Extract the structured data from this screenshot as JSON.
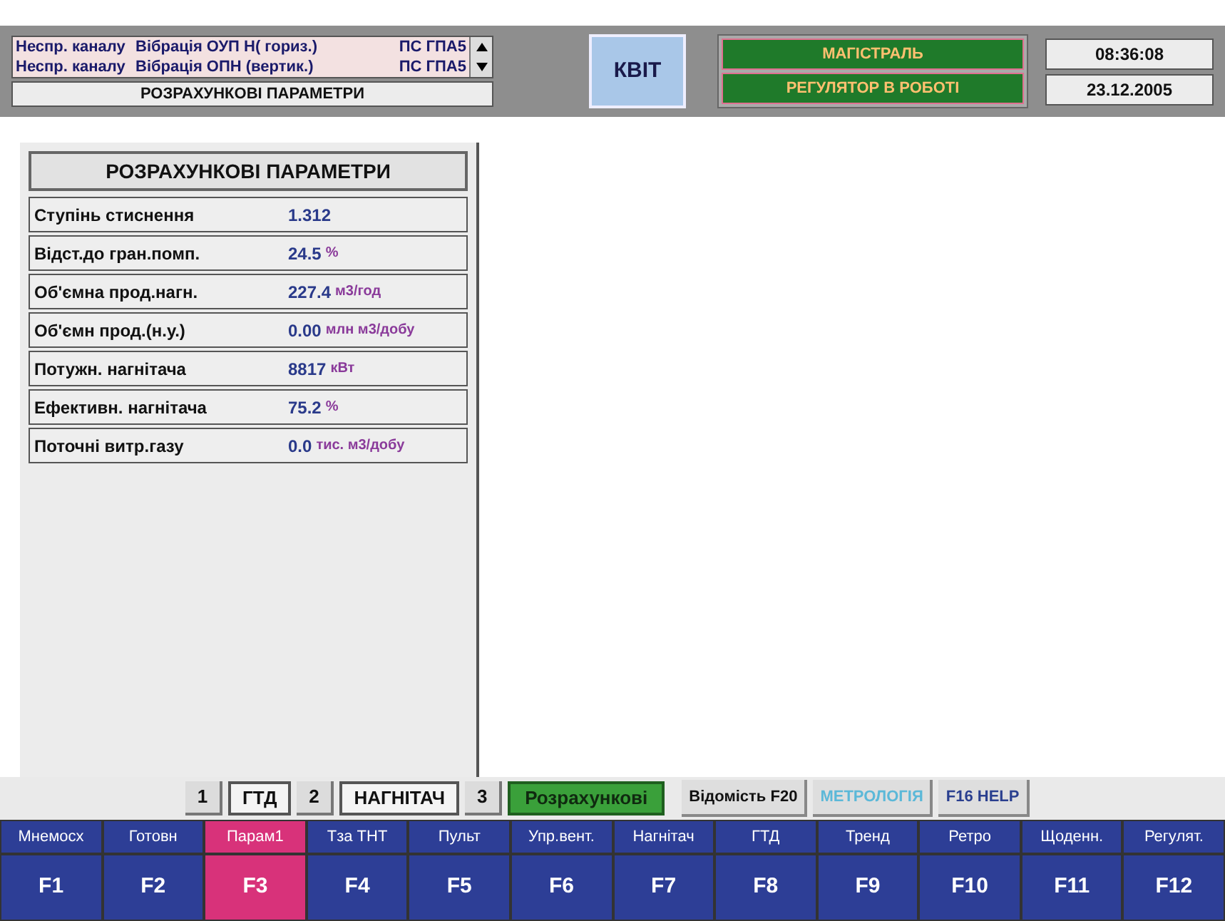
{
  "alarms": [
    {
      "source": "Неспр. каналу",
      "message": "Вібрація ОУП Н( гориз.)",
      "unit": "ПС ГПА5"
    },
    {
      "source": "Неспр. каналу",
      "message": "Вібрація ОПН (вертик.)",
      "unit": "ПС ГПА5"
    }
  ],
  "screen_title": "РОЗРАХУНКОВІ ПАРАМЕТРИ",
  "ack_button": "КВІТ",
  "status": [
    "МАГІСТРАЛЬ",
    "РЕГУЛЯТОР В РОБОТІ"
  ],
  "time": "08:36:08",
  "date": "23.12.2005",
  "panel": {
    "title": "РОЗРАХУНКОВІ ПАРАМЕТРИ",
    "rows": [
      {
        "label": "Ступінь стиснення",
        "value": "1.312",
        "unit": ""
      },
      {
        "label": "Відст.до гран.помп.",
        "value": "24.5",
        "unit": "%"
      },
      {
        "label": "Об'ємна прод.нагн.",
        "value": "227.4",
        "unit": "м3/год"
      },
      {
        "label": "Об'ємн прод.(н.у.)",
        "value": "0.00",
        "unit": "млн м3/добу"
      },
      {
        "label": "Потужн. нагнітача",
        "value": "8817",
        "unit": "кВт"
      },
      {
        "label": "Ефективн. нагнітача",
        "value": "75.2",
        "unit": "%"
      },
      {
        "label": "Поточні витр.газу",
        "value": "0.0",
        "unit": "тис. м3/добу"
      }
    ]
  },
  "tabs": [
    {
      "number": "1",
      "label": "ГТД",
      "selected": false
    },
    {
      "number": "2",
      "label": "НАГНІТАЧ",
      "selected": false
    },
    {
      "number": "3",
      "label": "Розрахункові",
      "selected": true
    }
  ],
  "links": [
    {
      "label": "Відомість F20",
      "color": "#111111"
    },
    {
      "label": "МЕТРОЛОГІЯ",
      "color": "#5bb8d8"
    },
    {
      "label": "F16 HELP",
      "color": "#2a3f8f"
    }
  ],
  "function_keys": [
    {
      "label": "Мнемосх",
      "key": "F1",
      "selected": false
    },
    {
      "label": "Готовн",
      "key": "F2",
      "selected": false
    },
    {
      "label": "Парам1",
      "key": "F3",
      "selected": true
    },
    {
      "label": "Тза ТНТ",
      "key": "F4",
      "selected": false
    },
    {
      "label": "Пульт",
      "key": "F5",
      "selected": false
    },
    {
      "label": "Упр.вент.",
      "key": "F6",
      "selected": false
    },
    {
      "label": "Нагнітач",
      "key": "F7",
      "selected": false
    },
    {
      "label": "ГТД",
      "key": "F8",
      "selected": false
    },
    {
      "label": "Тренд",
      "key": "F9",
      "selected": false
    },
    {
      "label": "Ретро",
      "key": "F10",
      "selected": false
    },
    {
      "label": "Щоденн.",
      "key": "F11",
      "selected": false
    },
    {
      "label": "Регулят.",
      "key": "F12",
      "selected": false
    }
  ]
}
